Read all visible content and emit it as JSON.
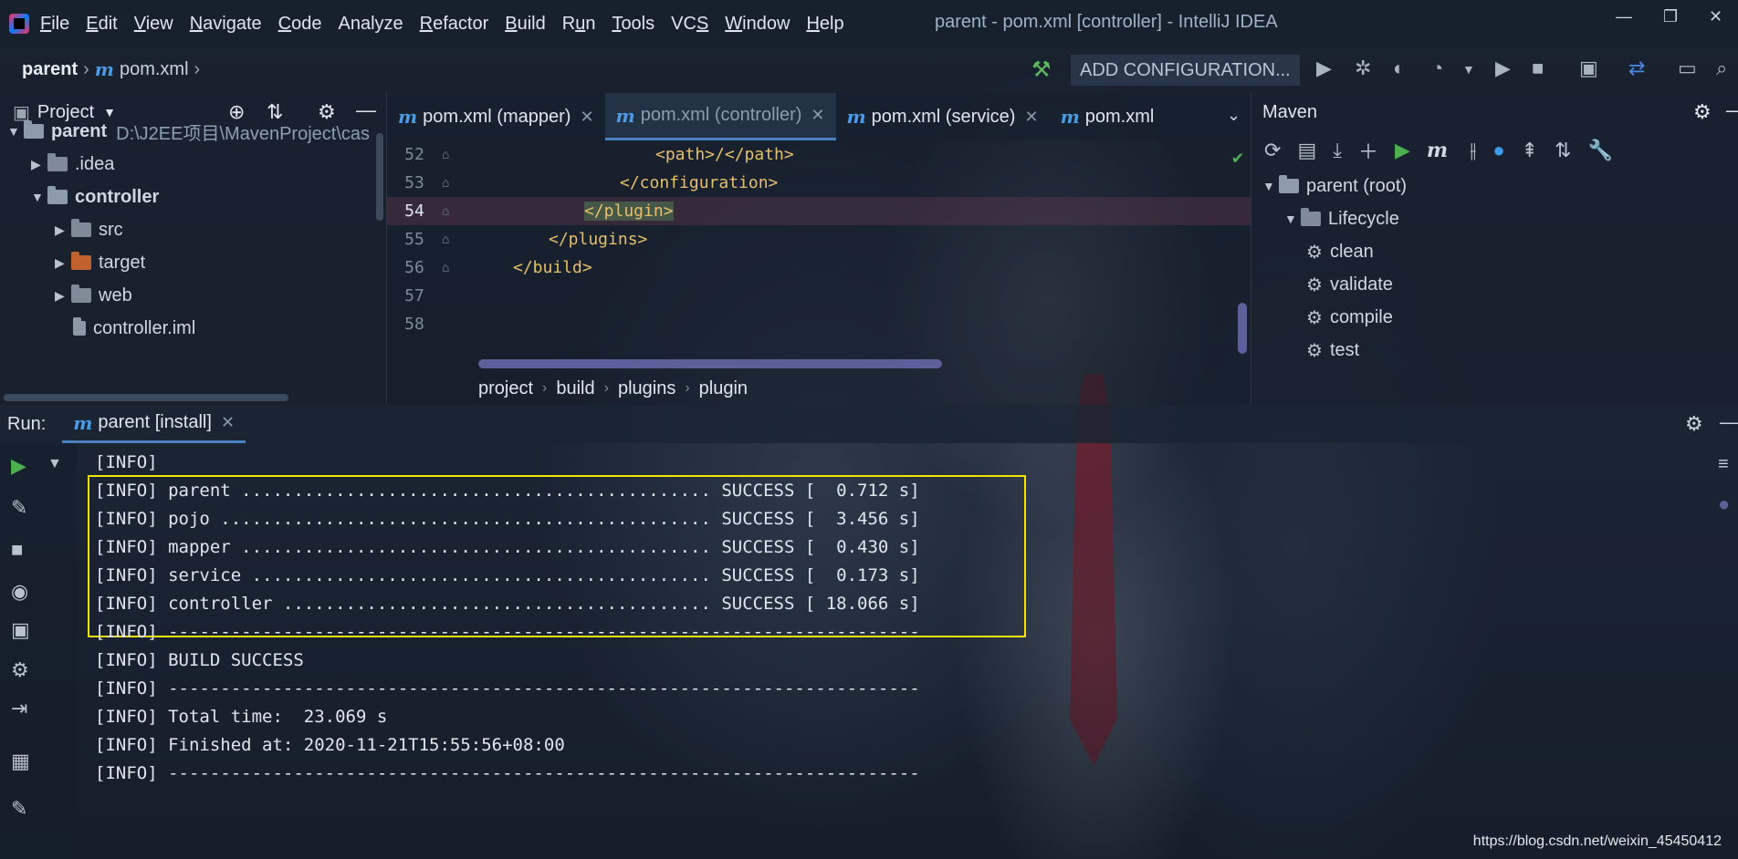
{
  "menu": {
    "items": [
      {
        "label": "File",
        "key": "F"
      },
      {
        "label": "Edit",
        "key": "E"
      },
      {
        "label": "View",
        "key": "V"
      },
      {
        "label": "Navigate",
        "key": "N"
      },
      {
        "label": "Code",
        "key": "C"
      },
      {
        "label": "Analyze",
        "key": ""
      },
      {
        "label": "Refactor",
        "key": "R"
      },
      {
        "label": "Build",
        "key": "B"
      },
      {
        "label": "Run",
        "key": "u"
      },
      {
        "label": "Tools",
        "key": "T"
      },
      {
        "label": "VCS",
        "key": "S"
      },
      {
        "label": "Window",
        "key": "W"
      },
      {
        "label": "Help",
        "key": "H"
      }
    ]
  },
  "window": {
    "title": "parent - pom.xml [controller] - IntelliJ IDEA",
    "minimize": "—",
    "restore": "❐",
    "close": "✕"
  },
  "navbar": {
    "root": "parent",
    "file": "pom.xml",
    "add_configuration": "ADD CONFIGURATION..."
  },
  "project": {
    "title": "Project",
    "tree": [
      {
        "label": "parent",
        "path": "D:\\J2EE项目\\MavenProject\\cas",
        "bold": true,
        "arrow": "▼",
        "type": "module"
      },
      {
        "label": ".idea",
        "arrow": "▶",
        "type": "folder"
      },
      {
        "label": "controller",
        "arrow": "▼",
        "bold": true,
        "type": "module"
      },
      {
        "label": "src",
        "arrow": "▶",
        "type": "folder"
      },
      {
        "label": "target",
        "arrow": "▶",
        "type": "folder-orange"
      },
      {
        "label": "web",
        "arrow": "▶",
        "type": "folder"
      },
      {
        "label": "controller.iml",
        "arrow": "",
        "type": "file"
      }
    ]
  },
  "editor": {
    "tabs": [
      {
        "label": "pom.xml (mapper)",
        "closable": true,
        "active": false
      },
      {
        "label": "pom.xml (controller)",
        "closable": true,
        "active": true
      },
      {
        "label": "pom.xml (service)",
        "closable": true,
        "active": false
      },
      {
        "label": "pom.xml",
        "closable": false,
        "active": false
      }
    ],
    "lines": [
      {
        "num": "52",
        "code": "<path>/</path>",
        "indent": 6
      },
      {
        "num": "53",
        "code": "</configuration>",
        "indent": 5
      },
      {
        "num": "54",
        "code": "</plugin>",
        "indent": 4,
        "current": true
      },
      {
        "num": "55",
        "code": "</plugins>",
        "indent": 3
      },
      {
        "num": "56",
        "code": "</build>",
        "indent": 2
      },
      {
        "num": "57",
        "code": "",
        "indent": 0
      },
      {
        "num": "58",
        "code": "",
        "indent": 0
      }
    ],
    "breadcrumbs": [
      "project",
      "build",
      "plugins",
      "plugin"
    ]
  },
  "maven": {
    "title": "Maven",
    "tree": [
      {
        "label": "parent (root)",
        "arrow": "▼",
        "level": 0
      },
      {
        "label": "Lifecycle",
        "arrow": "▼",
        "level": 1
      },
      {
        "label": "clean",
        "level": 2
      },
      {
        "label": "validate",
        "level": 2
      },
      {
        "label": "compile",
        "level": 2
      },
      {
        "label": "test",
        "level": 2
      }
    ]
  },
  "run": {
    "label": "Run:",
    "tab": "parent [install]",
    "console": [
      "[INFO]",
      "[INFO] parent ............................................. SUCCESS [  0.712 s]",
      "[INFO] pojo ............................................... SUCCESS [  3.456 s]",
      "[INFO] mapper ............................................. SUCCESS [  0.430 s]",
      "[INFO] service ............................................ SUCCESS [  0.173 s]",
      "[INFO] controller ......................................... SUCCESS [ 18.066 s]",
      "[INFO] ------------------------------------------------------------------------",
      "[INFO] BUILD SUCCESS",
      "[INFO] ------------------------------------------------------------------------",
      "[INFO] Total time:  23.069 s",
      "[INFO] Finished at: 2020-11-21T15:55:56+08:00",
      "[INFO] ------------------------------------------------------------------------"
    ]
  },
  "watermark": "https://blog.csdn.net/weixin_45450412",
  "colors": {
    "accent": "#4a7fc0",
    "highlight_box": "#f5e400",
    "xml_tag": "#e8bf6a",
    "maven_m": "#4a9be8"
  }
}
